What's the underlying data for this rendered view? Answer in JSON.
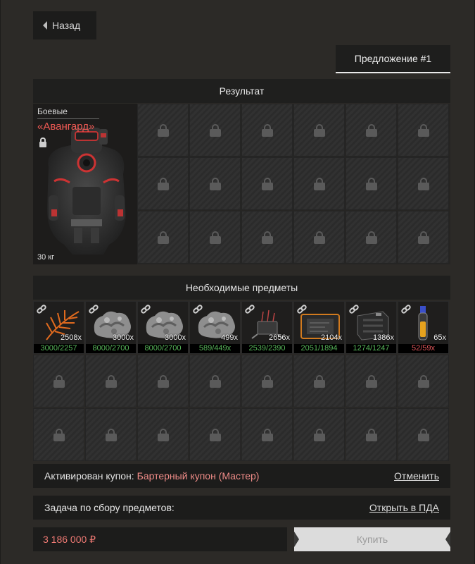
{
  "back_label": "Назад",
  "offer_tab": "Предложение #1",
  "result": {
    "header": "Результат",
    "item_category": "Боевые",
    "item_name": "«Авангард»",
    "item_weight": "30 кг"
  },
  "required": {
    "header": "Необходимые предметы",
    "items": [
      {
        "icon": "fern-plant-icon",
        "qty": "2508x",
        "have": "3000/2257",
        "status": "ok"
      },
      {
        "icon": "ore-rock-icon",
        "qty": "3000x",
        "have": "8000/2700",
        "status": "ok"
      },
      {
        "icon": "ore-rock-icon",
        "qty": "3000x",
        "have": "8000/2700",
        "status": "ok"
      },
      {
        "icon": "ore-rock-icon",
        "qty": "499x",
        "have": "589/449x",
        "status": "ok"
      },
      {
        "icon": "wire-component-icon",
        "qty": "2656x",
        "have": "2539/2390",
        "status": "ok"
      },
      {
        "icon": "circuit-board-icon",
        "qty": "2104x",
        "have": "2051/1894",
        "status": "ok"
      },
      {
        "icon": "battery-block-icon",
        "qty": "1386x",
        "have": "1274/1247",
        "status": "ok"
      },
      {
        "icon": "vial-icon",
        "qty": "65x",
        "have": "52/59x",
        "status": "bad"
      }
    ]
  },
  "coupon": {
    "label": "Активирован купон:",
    "value": "Бартерный купон (Мастер)",
    "cancel": "Отменить"
  },
  "task": {
    "label": "Задача по сбору предметов:",
    "open": "Открыть в ПДА"
  },
  "price": "3 186 000 ₽",
  "buy_label": "Купить",
  "colors": {
    "accent_red": "#f05a54",
    "ok_green": "#58b85a",
    "bad_red": "#e0565a"
  }
}
